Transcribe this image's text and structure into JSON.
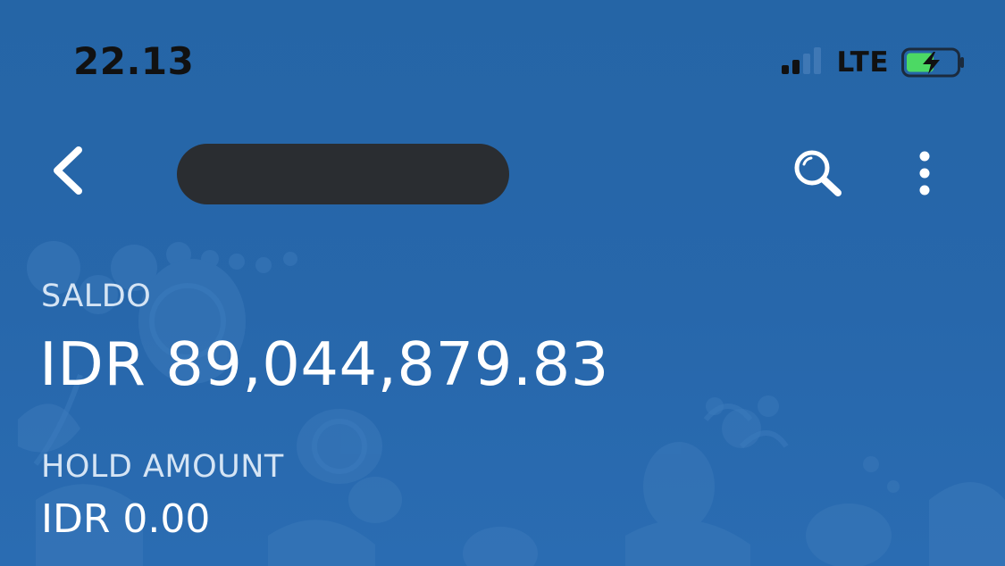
{
  "status_bar": {
    "time": "22.13",
    "network": "LTE",
    "signal_icon": "cellular-signal-icon",
    "battery_icon": "battery-charging-icon",
    "battery_color": "#4cd964"
  },
  "app_bar": {
    "back_icon": "chevron-left-icon",
    "title": "",
    "search_icon": "search-icon",
    "more_icon": "more-vertical-icon"
  },
  "account": {
    "balance_label": "SALDO",
    "balance_value": "IDR 89,044,879.83",
    "hold_label": "HOLD AMOUNT",
    "hold_value": "IDR 0.00"
  },
  "colors": {
    "background": "#2767ab",
    "text_primary": "#ffffff",
    "text_label": "#d5e4f4",
    "redaction": "#2a2d31"
  }
}
